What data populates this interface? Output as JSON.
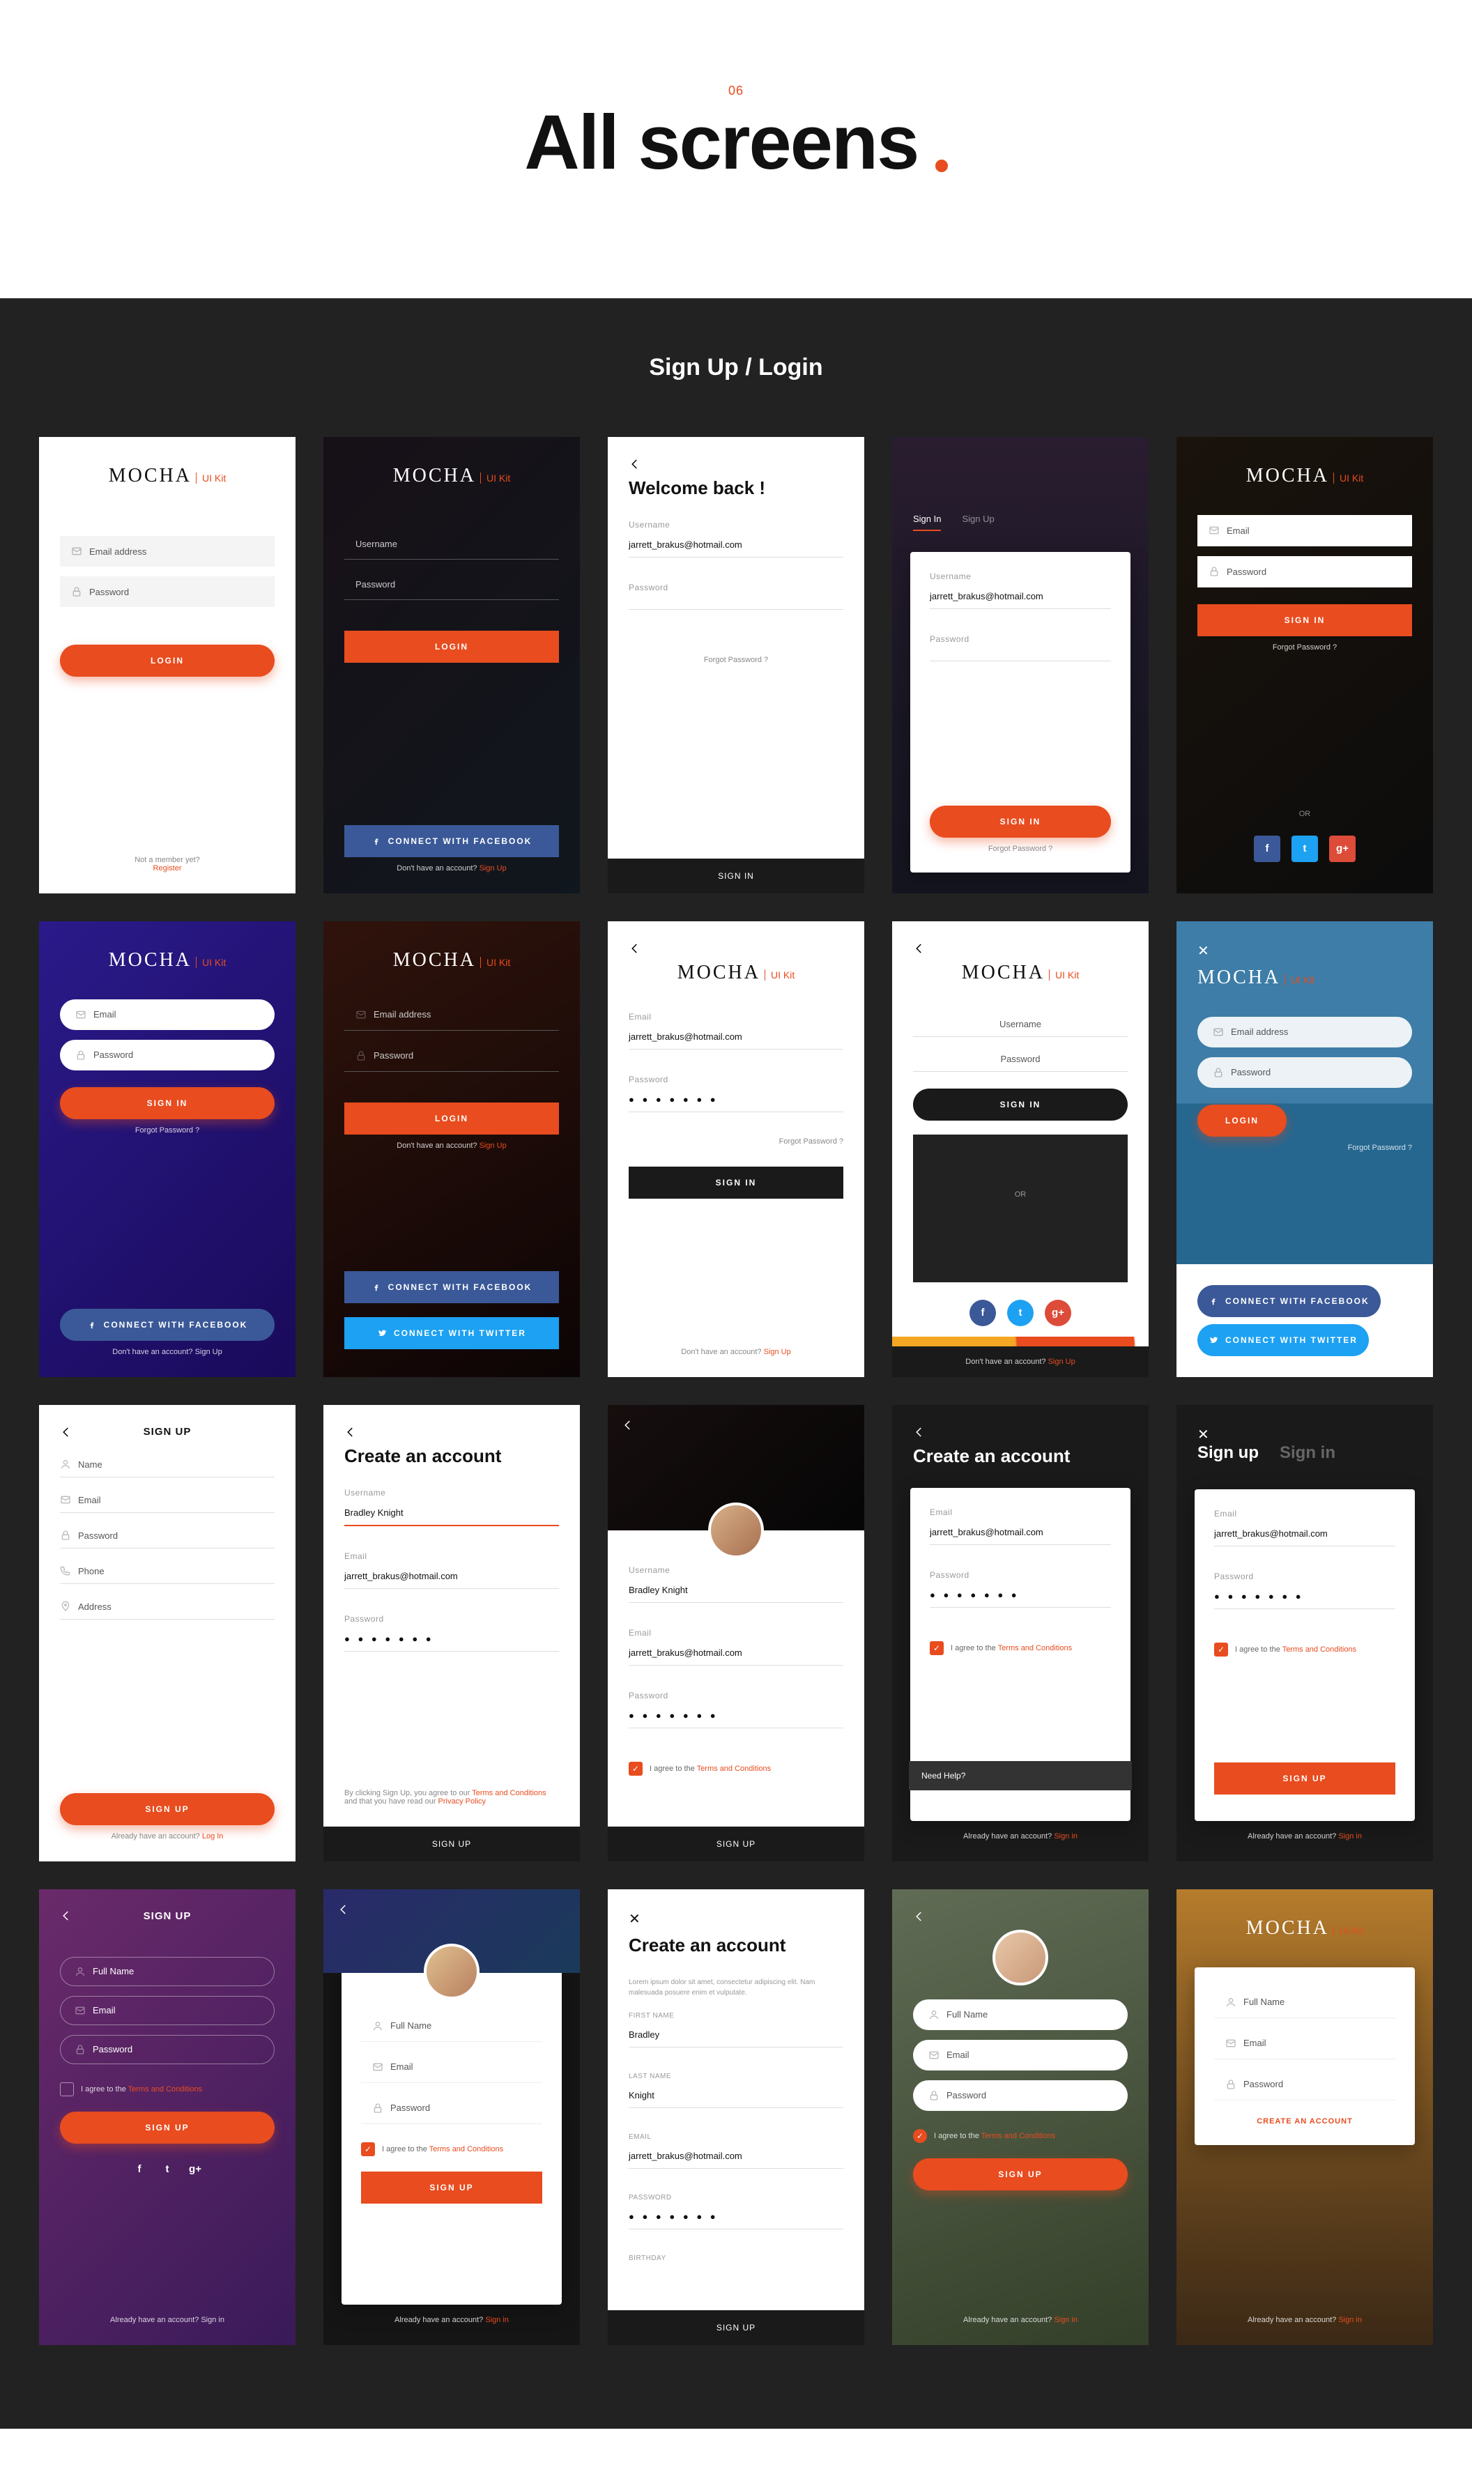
{
  "page": {
    "number": "06",
    "title": "All screens",
    "section": "Sign Up / Login"
  },
  "brand": {
    "name": "MOCHA",
    "kit": "UI Kit"
  },
  "common": {
    "email_ph": "Email address",
    "email_short": "Email",
    "password_ph": "Password",
    "username_ph": "Username",
    "fullname_ph": "Full Name",
    "name_ph": "Name",
    "phone_ph": "Phone",
    "address_ph": "Address",
    "email_val": "jarrett_brakus@hotmail.com",
    "name_val": "Bradley Knight",
    "first_val": "Bradley",
    "last_val": "Knight",
    "dots": "● ● ● ● ● ● ●",
    "login": "LOGIN",
    "signin": "SIGN IN",
    "signup": "SIGN UP",
    "create_account_btn": "CREATE AN ACCOUNT",
    "forgot": "Forgot Password ?",
    "fb": "CONNECT WITH FACEBOOK",
    "tw": "CONNECT WITH TWITTER",
    "no_account": "Don't have an account?",
    "signup_link": "Sign Up",
    "have_account": "Already have an account?",
    "signin_link": "Sign in",
    "login_link": "Log In",
    "not_member": "Not a member yet?",
    "register": "Register",
    "or": "OR",
    "need_help": "Need Help?",
    "terms_pre": "I agree to the ",
    "terms": "Terms and Conditions",
    "terms_long_pre": "By clicking Sign Up, you agree to our ",
    "terms_long_mid": " and that you have read our ",
    "privacy": "Privacy Policy",
    "lorem": "Lorem ipsum dolor sit amet, consectetur adipiscing elit. Nam malesuada posuere enim et vulputate."
  },
  "titles": {
    "welcome_back": "Welcome back !",
    "create_account": "Create an account",
    "signup_tab": "Sign up",
    "signin_tab": "Sign in",
    "signin_t": "Sign In",
    "signup_t": "Sign Up"
  },
  "labels": {
    "username": "Username",
    "password": "Password",
    "email": "Email",
    "first": "FIRST NAME",
    "last": "LAST NAME",
    "email_u": "EMAIL",
    "password_u": "PASSWORD",
    "birthday": "BIRTHDAY"
  }
}
